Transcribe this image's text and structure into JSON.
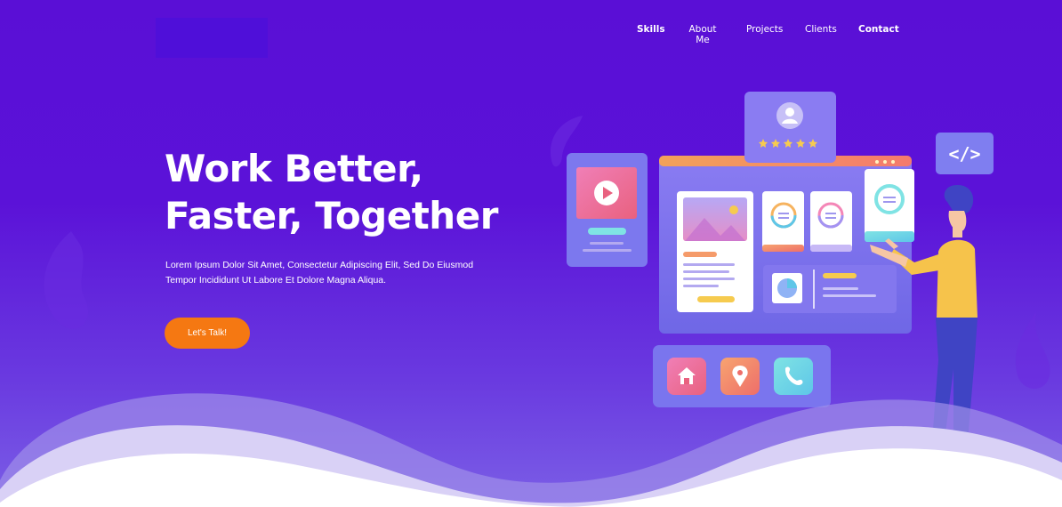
{
  "nav": {
    "items": [
      "Skills",
      "About Me",
      "Projects",
      "Clients",
      "Contact"
    ]
  },
  "hero": {
    "headline_line1": "Work Better,",
    "headline_line2": "Faster, Together",
    "description_line1": "Lorem Ipsum Dolor Sit Amet, Consectetur Adipiscing Elit, Sed Do Eiusmod",
    "description_line2": "Tempor Incididunt Ut Labore Et Dolore Magna Aliqua.",
    "cta_label": "Let's Talk!"
  },
  "illustration": {
    "code_tag": "</>",
    "rating_stars": 5
  },
  "colors": {
    "background": "#5a0fd6",
    "cta": "#f57812",
    "text": "#ffffff"
  },
  "icons": [
    "play-icon",
    "user-icon",
    "star-icon",
    "code-icon",
    "home-icon",
    "location-pin-icon",
    "phone-icon",
    "pie-chart-icon",
    "image-icon"
  ]
}
